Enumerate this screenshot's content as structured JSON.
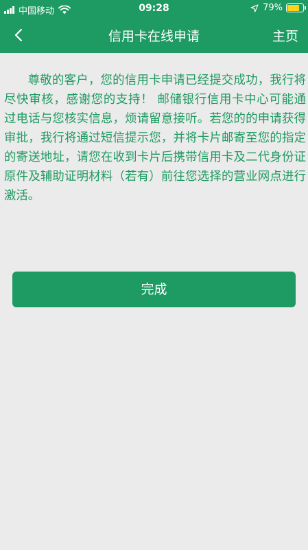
{
  "status_bar": {
    "carrier": "中国移动",
    "time": "09:28",
    "battery": "79%",
    "battery_level": 0.79,
    "icons": [
      "signal-icon",
      "wifi-icon",
      "location-arrow-icon",
      "battery-icon"
    ]
  },
  "nav": {
    "title": "信用卡在线申请",
    "home_label": "主页",
    "back_icon": "chevron-left-icon"
  },
  "message": {
    "text": "尊敬的客户，您的信用卡申请已经提交成功，我行将尽快审核，感谢您的支持！ 邮储银行信用卡中心可能通过电话与您核实信息，烦请留意接听。若您的的申请获得审批，我行将通过短信提示您，并将卡片邮寄至您的指定的寄送地址，请您在收到卡片后携带信用卡及二代身份证原件及辅助证明材料（若有）前往您选择的营业网点进行激活。"
  },
  "actions": {
    "done_label": "完成"
  },
  "colors": {
    "brand_green": "#1d9b63",
    "text_green": "#1e9a60",
    "background": "#ebebeb",
    "battery_yellow": "#ffd21f"
  }
}
